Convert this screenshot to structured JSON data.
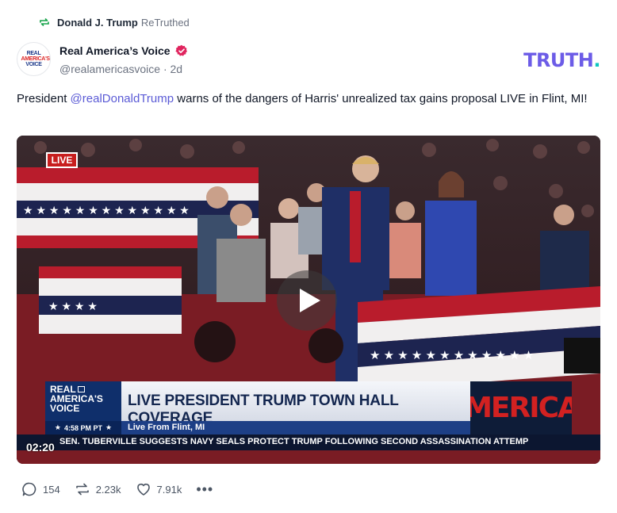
{
  "retruth": {
    "user": "Donald J. Trump",
    "verb": "ReTruthed",
    "icon": "retruth-icon"
  },
  "author": {
    "display_name": "Real America’s Voice",
    "handle": "@realamericasvoice",
    "age": "2d",
    "avatar_lines": [
      "REAL",
      "AMERICA'S",
      "VOICE"
    ],
    "verified_icon": "verified-badge-icon"
  },
  "brand": {
    "logo_text": "TRUTH",
    "logo_dot": ".",
    "accent": "#6c5ce7",
    "dot_color": "#10c7c0"
  },
  "post": {
    "prefix": "President ",
    "mention": "@realDonaldTrump",
    "suffix": " warns of the dangers of Harris' unrealized tax gains proposal LIVE in Flint, MI!"
  },
  "video": {
    "live_badge": "LIVE",
    "duration": "02:20",
    "play_icon": "play-icon",
    "lower_third": {
      "logo_lines": [
        "REAL",
        "AMERICA'S",
        "VOICE"
      ],
      "time": "4:58 PM PT",
      "headline": "LIVE PRESIDENT TRUMP TOWN HALL COVERAGE",
      "sub": "Live From Flint, MI",
      "merica": "MERICA",
      "ticker": "SEN. TUBERVILLE SUGGESTS NAVY SEALS PROTECT TRUMP FOLLOWING SECOND ASSASSINATION ATTEMP"
    }
  },
  "actions": {
    "replies": "154",
    "retruths": "2.23k",
    "likes": "7.91k",
    "more": "•••"
  }
}
